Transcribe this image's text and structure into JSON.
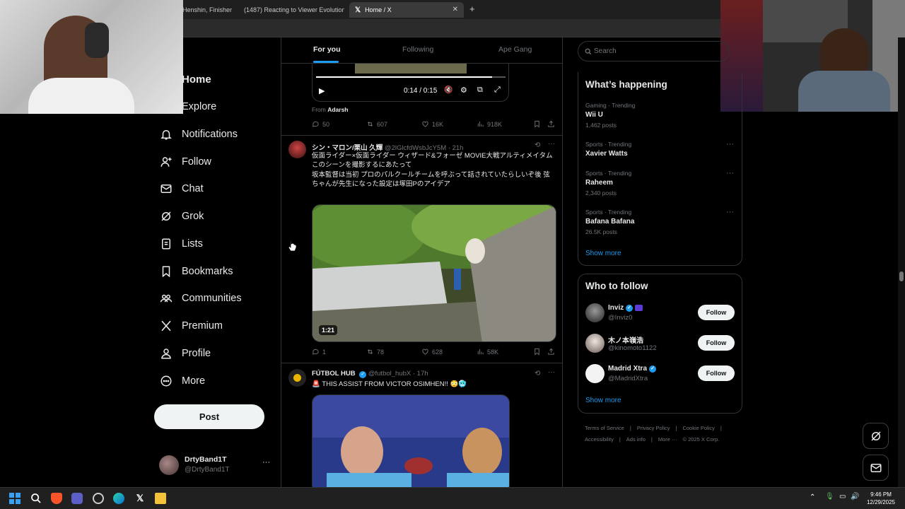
{
  "browser": {
    "tabs": [
      {
        "label": "Henshin, Finisher"
      },
      {
        "label": "(1487) Reacting to Viewer Evolutions"
      },
      {
        "label": "Home / X",
        "active": true
      }
    ],
    "new_tab_icon": "plus-icon"
  },
  "nav": {
    "items": [
      {
        "label": "Home",
        "icon": "home-icon"
      },
      {
        "label": "Explore",
        "icon": "search-icon"
      },
      {
        "label": "Notifications",
        "icon": "bell-icon"
      },
      {
        "label": "Follow",
        "icon": "person-add-icon"
      },
      {
        "label": "Chat",
        "icon": "mail-icon"
      },
      {
        "label": "Grok",
        "icon": "grok-icon"
      },
      {
        "label": "Lists",
        "icon": "list-icon"
      },
      {
        "label": "Bookmarks",
        "icon": "bookmark-icon"
      },
      {
        "label": "Communities",
        "icon": "people-icon"
      },
      {
        "label": "Premium",
        "icon": "x-logo-icon"
      },
      {
        "label": "Profile",
        "icon": "person-icon"
      },
      {
        "label": "More",
        "icon": "more-circle-icon"
      }
    ],
    "post_label": "Post",
    "account": {
      "name": "DrtyBand1T",
      "handle": "@DrtyBand1T",
      "more": "···"
    }
  },
  "feed": {
    "tabs": [
      {
        "label": "For you",
        "active": true
      },
      {
        "label": "Following"
      },
      {
        "label": "Ape Gang"
      }
    ],
    "top_video": {
      "time": "0:14 / 0:15",
      "from_label": "From",
      "from_name": "Adarsh",
      "progress": 0.93
    },
    "top_actions": {
      "replies": "50",
      "reposts": "607",
      "likes": "16K",
      "views": "918K"
    },
    "tweets": [
      {
        "name": "シン・マロン/栗山 久輝",
        "handle": "@2lGlcfdWsbJcY5M",
        "time": "· 21h",
        "lines": [
          "仮面ライダー×仮面ライダー ウィザード&フォーゼ MOVIE大戦アルティメイタム",
          "このシーンを撮影するにあたって",
          "坂本監督は当初 プロのパルクールチームを呼ぶって話されていたらしいぞ後 弦ちゃんが先生になった設定は塚田Pのアイデア"
        ],
        "duration": "1:21",
        "replies": "1",
        "reposts": "78",
        "likes": "628",
        "views": "58K"
      },
      {
        "name": "FÚTBOL HUB",
        "handle": "@futbol_hubX",
        "time": "· 17h",
        "lines": [
          "🚨 THIS ASSIST FROM VICTOR OSIMHEN!! 😳🥶"
        ]
      }
    ]
  },
  "right": {
    "search_placeholder": "Search",
    "happening_title": "What’s happening",
    "trends": [
      {
        "category": "Gaming · Trending",
        "name": "Wii U",
        "posts": "1,462 posts"
      },
      {
        "category": "Sports · Trending",
        "name": "Xavier Watts",
        "posts": ""
      },
      {
        "category": "Sports · Trending",
        "name": "Raheem",
        "posts": "2,340 posts"
      },
      {
        "category": "Sports · Trending",
        "name": "Bafana Bafana",
        "posts": "26.5K posts"
      }
    ],
    "show_more": "Show more",
    "wtf_title": "Who to follow",
    "who_to_follow": [
      {
        "name": "Inviz",
        "handle": "@Inviz0",
        "button": "Follow"
      },
      {
        "name": "木ノ本嶺浩",
        "handle": "@kinomoto1122",
        "button": "Follow"
      },
      {
        "name": "Madrid Xtra",
        "handle": "@MadridXtra",
        "button": "Follow"
      }
    ],
    "footer": [
      "Terms of Service",
      "|",
      "Privacy Policy",
      "|",
      "Cookie Policy",
      "|",
      "Accessibility",
      "|",
      "Ads info",
      "|",
      "More ···",
      "© 2025 X Corp."
    ]
  },
  "taskbar": {
    "time": "9:46 PM",
    "date": "12/29/2025"
  },
  "colors": {
    "accent": "#1d9bf0",
    "background": "#000000",
    "border": "#2f3336"
  }
}
